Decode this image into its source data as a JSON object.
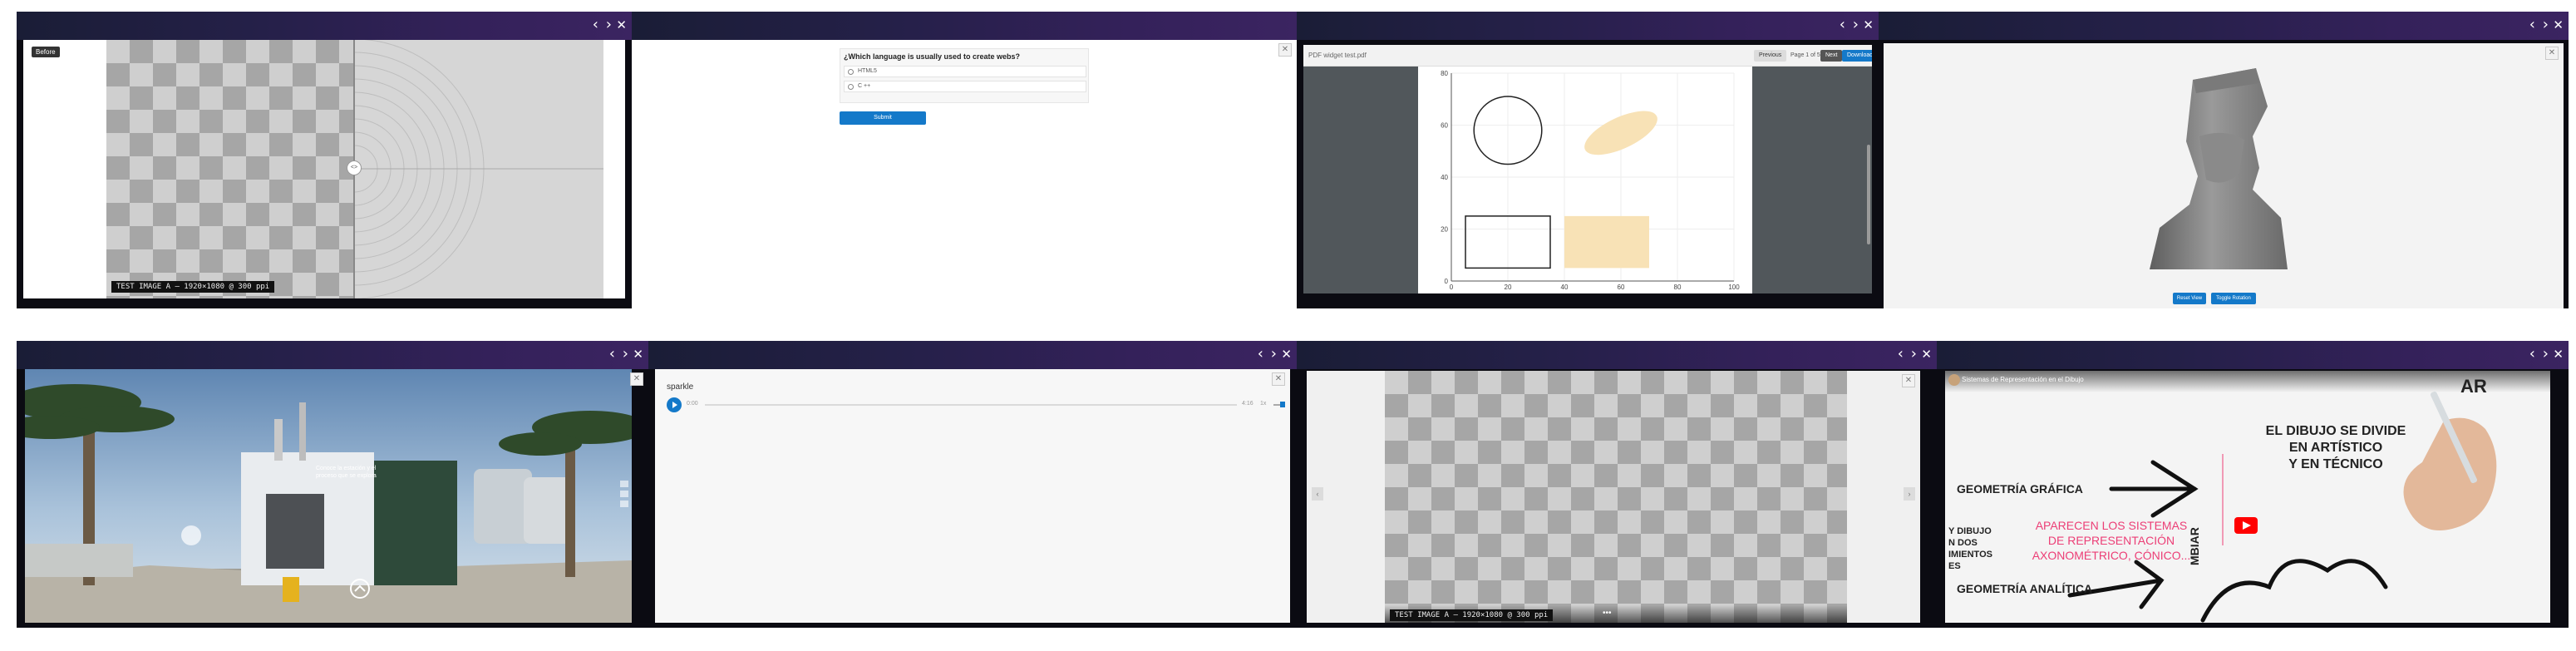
{
  "window_controls": {
    "prev": "‹",
    "next": "›",
    "close": "✕"
  },
  "panel_close": "✕",
  "comparison": {
    "before_label": "Before",
    "handle": "<>",
    "caption": "TEST IMAGE A — 1920×1080 @ 300 ppi"
  },
  "quiz": {
    "question": "¿Which language is usually used to create webs?",
    "options": [
      "HTML5",
      "C ++"
    ],
    "submit_label": "Submit"
  },
  "pdf": {
    "filename": "PDF widget test.pdf",
    "previous_label": "Previous",
    "page_label": "Page 1 of 5",
    "next_label": "Next",
    "download_label": "Download",
    "chart_data": {
      "type": "scatter",
      "title": "",
      "xlabel": "",
      "ylabel": "",
      "xlim": [
        0,
        100
      ],
      "ylim": [
        0,
        80
      ],
      "x_ticks": [
        0,
        20,
        40,
        60,
        80,
        100
      ],
      "y_ticks": [
        0,
        20,
        40,
        60,
        80
      ],
      "grid": true,
      "series": [
        {
          "shape": "circle",
          "cx": 20,
          "cy": 58,
          "r": 12,
          "fill": "none",
          "stroke": "#222222"
        },
        {
          "shape": "ellipse",
          "cx": 60,
          "cy": 57,
          "rx": 14,
          "ry": 6,
          "fill": "#f8e2b6",
          "stroke": "none"
        },
        {
          "shape": "rect",
          "x": 5,
          "y": 5,
          "w": 30,
          "h": 20,
          "fill": "none",
          "stroke": "#222222"
        },
        {
          "shape": "rect",
          "x": 40,
          "y": 5,
          "w": 30,
          "h": 20,
          "fill": "#f8e2b6",
          "stroke": "none"
        }
      ]
    }
  },
  "model3d": {
    "reset_label": "Reset View",
    "rotate_label": "Toggle Rotation"
  },
  "panorama": {
    "hotspot_text": "Conoce la estación y el proceso que se explora"
  },
  "audio": {
    "title": "sparkle",
    "current_time": "0:00",
    "duration": "4:16",
    "speed": "1x"
  },
  "gallery": {
    "caption": "TEST IMAGE A — 1920×1080 @ 300 ppi",
    "prev": "‹",
    "next": "›",
    "dots": "•••"
  },
  "video": {
    "title": "Sistemas de Representación en el Dibujo",
    "top_word": "AR",
    "heading1": "EL DIBUJO SE DIVIDE",
    "heading2": "EN ARTÍSTICO",
    "heading3": "Y EN TÉCNICO",
    "geo_grafica": "GEOMETRÍA GRÁFICA",
    "pink1": "APARECEN LOS SISTEMAS",
    "pink2": "DE REPRESENTACIÓN",
    "pink3": "AXONOMÉTRICO, CÓNICO...",
    "left_partial": "Y DIBUJO\nN DOS\nIMIENTOS\nES",
    "cambiar": "MBIAR",
    "geo_analitica": "GEOMETRÍA ANALÍTICA",
    "brand_color": "#ff0000"
  }
}
